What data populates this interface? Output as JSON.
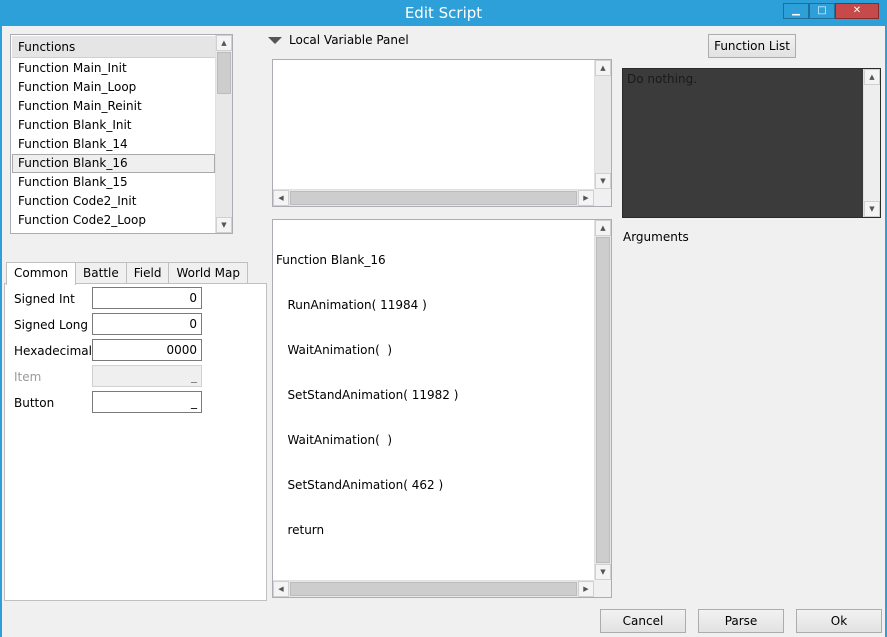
{
  "window": {
    "title": "Edit Script",
    "buttons": [
      "minimize",
      "maximize",
      "close"
    ]
  },
  "functions": {
    "header": "Functions",
    "items": [
      "Function Main_Init",
      "Function Main_Loop",
      "Function Main_Reinit",
      "Function Blank_Init",
      "Function Blank_14",
      "Function Blank_16",
      "Function Blank_15",
      "Function Code2_Init",
      "Function Code2_Loop"
    ],
    "selected_index": 5
  },
  "tabs": [
    "Common",
    "Battle",
    "Field",
    "World Map"
  ],
  "active_tab": "Common",
  "fields": [
    {
      "label": "Signed Int",
      "value": "0",
      "enabled": true
    },
    {
      "label": "Signed Long",
      "value": "0",
      "enabled": true
    },
    {
      "label": "Hexadecimal",
      "value": "0000",
      "enabled": true
    },
    {
      "label": "Item",
      "value": "_",
      "enabled": false
    },
    {
      "label": "Button",
      "value": "_",
      "enabled": true
    }
  ],
  "local_variable_panel": {
    "label": "Local Variable Panel"
  },
  "code": {
    "lines": [
      "Function Blank_16",
      "   RunAnimation( 11984 )",
      "   WaitAnimation(  )",
      "   SetStandAnimation( 11982 )",
      "   WaitAnimation(  )",
      "   SetStandAnimation( 462 )",
      "   return"
    ]
  },
  "function_list_button": "Function List",
  "description": {
    "text": "Do nothing."
  },
  "arguments_label": "Arguments",
  "footer": {
    "cancel": "Cancel",
    "parse": "Parse",
    "ok": "Ok"
  },
  "colors": {
    "titlebar": "#2d9fd9",
    "description_bg": "#3b3b3b",
    "selected_item_border": "#a9a9a9"
  }
}
